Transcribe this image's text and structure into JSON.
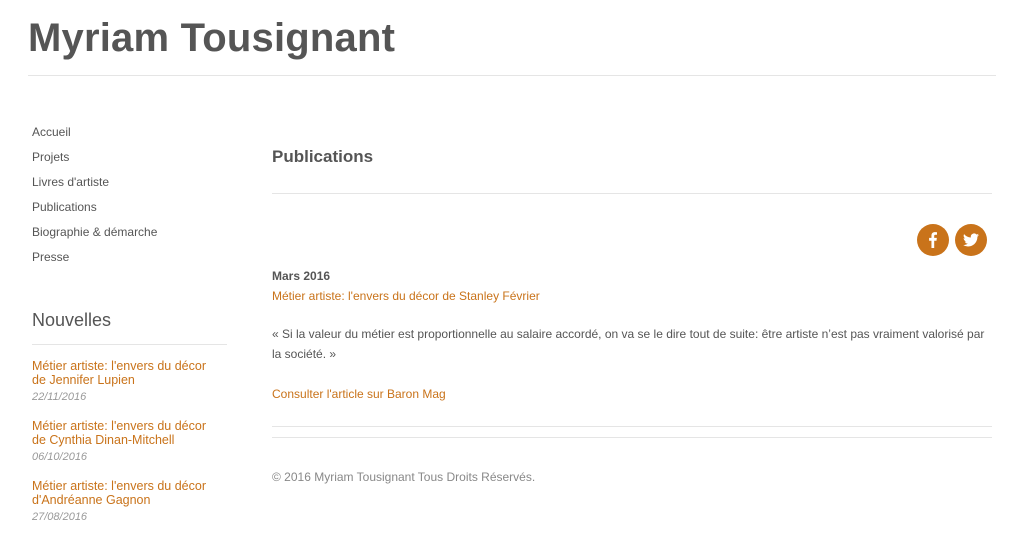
{
  "site": {
    "title": "Myriam Tousignant"
  },
  "nav": {
    "items": [
      {
        "label": "Accueil"
      },
      {
        "label": "Projets"
      },
      {
        "label": "Livres d'artiste"
      },
      {
        "label": "Publications"
      },
      {
        "label": "Biographie & démarche"
      },
      {
        "label": "Presse"
      }
    ]
  },
  "news": {
    "title": "Nouvelles",
    "items": [
      {
        "title": "Métier artiste: l'envers du décor de Jennifer Lupien",
        "date": "22/11/2016"
      },
      {
        "title": "Métier artiste: l'envers du décor de Cynthia Dinan-Mitchell",
        "date": "06/10/2016"
      },
      {
        "title": "Métier artiste: l'envers du décor d'Andréanne Gagnon",
        "date": "27/08/2016"
      }
    ]
  },
  "main": {
    "heading": "Publications",
    "share": {
      "facebook_icon": "facebook-icon",
      "twitter_icon": "twitter-icon"
    },
    "article": {
      "date": "Mars 2016",
      "title": "Métier artiste: l'envers du décor de Stanley Février",
      "quote": "« Si la valeur du métier est proportionnelle au salaire accordé, on va se le dire tout de suite: être artiste n’est pas vraiment valorisé par la société. »",
      "more": "Consulter l'article sur Baron Mag"
    }
  },
  "footer": {
    "text": "© 2016 Myriam Tousignant Tous Droits Réservés."
  },
  "colors": {
    "accent": "#c9731a",
    "text": "#555555",
    "rule": "#e5e5e5"
  }
}
